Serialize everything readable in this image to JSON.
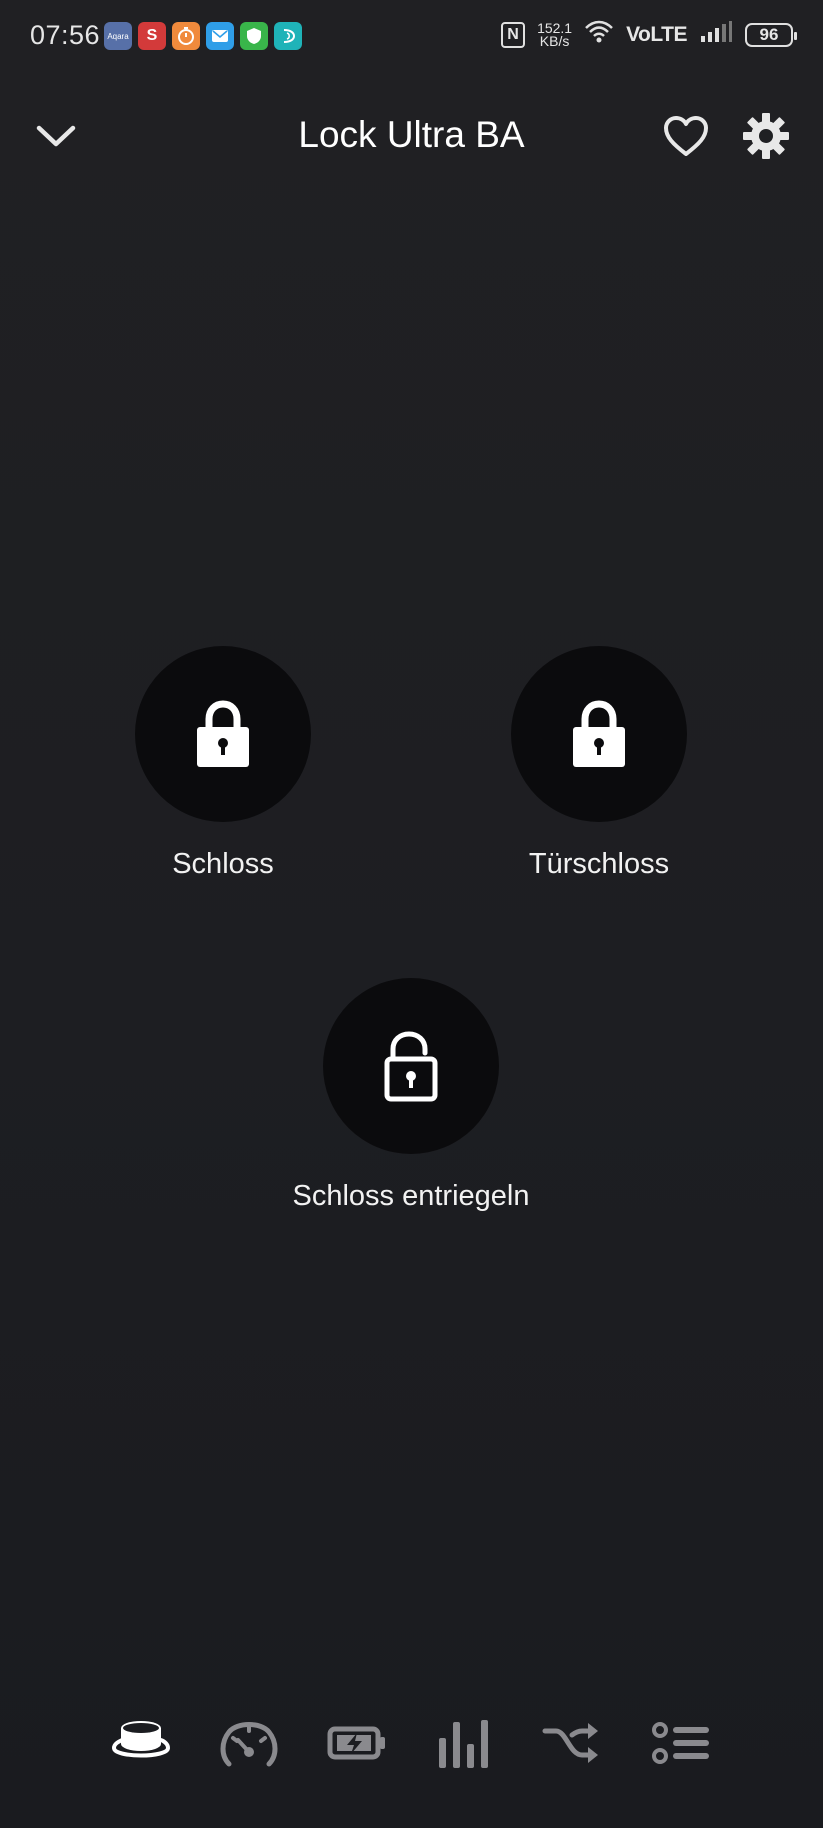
{
  "status_bar": {
    "time": "07:56",
    "apps": [
      {
        "icon": "aqara-app-icon",
        "color": "#5770a8",
        "label": "Aqara"
      },
      {
        "icon": "s-app-icon",
        "color": "#d33a3a",
        "label": "S"
      },
      {
        "icon": "timer-app-icon",
        "color": "#f08a3c",
        "label": ""
      },
      {
        "icon": "mail-app-icon",
        "color": "#2f9ee8",
        "label": ""
      },
      {
        "icon": "security-app-icon",
        "color": "#39b54a",
        "label": ""
      },
      {
        "icon": "teal-app-icon",
        "color": "#1fb3b8",
        "label": ""
      }
    ],
    "nfc_label": "N",
    "speed_value": "152.1",
    "speed_unit": "KB/s",
    "network": "VoLTE",
    "battery": "96"
  },
  "header": {
    "title": "Lock Ultra BA"
  },
  "actions": [
    {
      "label": "Schloss",
      "icon": "lock-closed-icon"
    },
    {
      "label": "Türschloss",
      "icon": "lock-closed-icon"
    },
    {
      "label": "Schloss entriegeln",
      "icon": "lock-open-icon"
    }
  ],
  "bottom_nav": [
    {
      "icon": "device-top-icon",
      "active": true
    },
    {
      "icon": "gauge-icon",
      "active": false
    },
    {
      "icon": "battery-charging-icon",
      "active": false
    },
    {
      "icon": "bar-chart-icon",
      "active": false
    },
    {
      "icon": "shuffle-icon",
      "active": false
    },
    {
      "icon": "list-settings-icon",
      "active": false
    }
  ],
  "colors": {
    "background": "#1d1e22",
    "tile_circle": "#0b0b0d",
    "nav_active": "#ffffff",
    "nav_inactive": "#8a8a8e"
  }
}
